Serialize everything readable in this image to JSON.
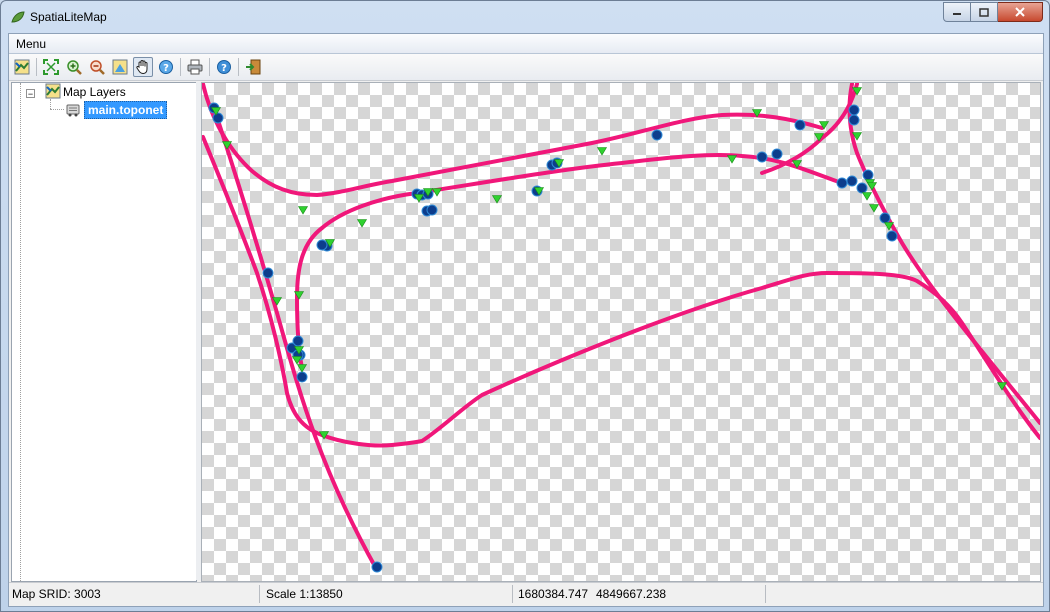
{
  "window": {
    "title": "SpatiaLiteMap"
  },
  "menu": {
    "items": [
      "Menu"
    ]
  },
  "toolbar": {
    "buttons": [
      {
        "name": "map-layers-icon"
      },
      {
        "name": "full-extent-icon"
      },
      {
        "name": "zoom-in-icon"
      },
      {
        "name": "zoom-out-icon"
      },
      {
        "name": "identify-icon"
      },
      {
        "name": "pan-hand-icon",
        "active": true
      },
      {
        "name": "help-icon"
      },
      {
        "name": "print-icon"
      },
      {
        "name": "info-icon"
      },
      {
        "name": "exit-icon"
      }
    ]
  },
  "tree": {
    "root_label": "Map Layers",
    "expander": "−",
    "layer_label": "main.toponet"
  },
  "status": {
    "srid": "Map SRID: 3003",
    "scale": "Scale 1:13850",
    "x": "1680384.747",
    "y": "4849667.238"
  },
  "colors": {
    "line": "#f0177a",
    "node": "#0d3d8c",
    "node_outline": "#2f8ad6",
    "marker": "#2fd12f",
    "selection": "#3399ff"
  }
}
